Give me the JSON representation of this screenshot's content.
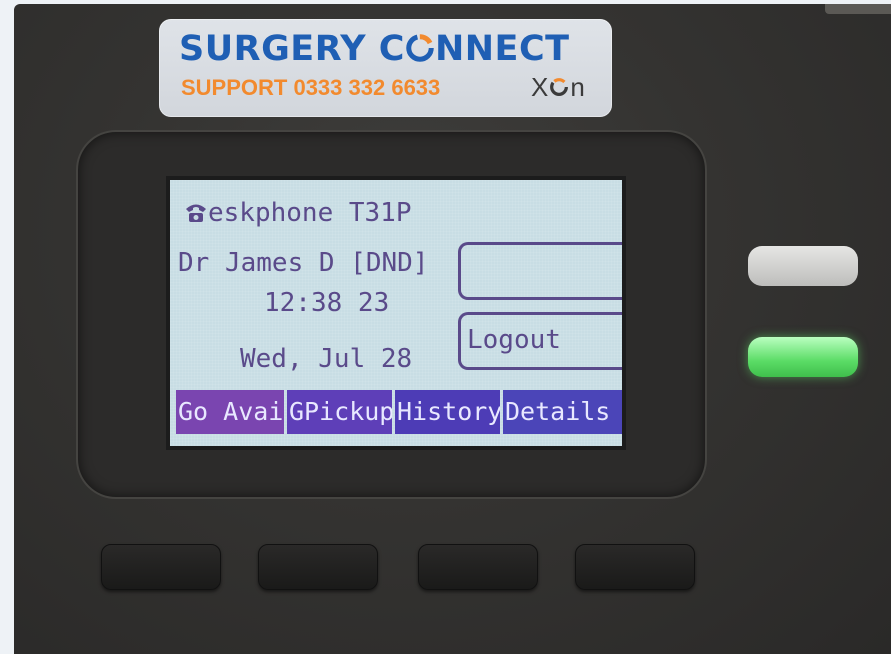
{
  "sticker": {
    "brand_prefix": "SURGERY C",
    "brand_suffix": "NNECT",
    "support": "SUPPORT 0333 332 6633",
    "logo_x": "X",
    "logo_n": "n"
  },
  "screen": {
    "title": "eskphone T31P",
    "user_status": "Dr James D [DND]",
    "time": "12:38 23",
    "date": "Wed, Jul 28",
    "line_keys": [
      "",
      "Logout"
    ],
    "softkeys": [
      "Go Avai",
      "GPickup",
      "History",
      "Details"
    ]
  },
  "colors": {
    "brand_blue": "#1f5fb4",
    "brand_orange": "#f28a2e",
    "lcd_text": "#5a4a8a",
    "line_key_led": "#5bdc66"
  },
  "icons": {
    "title_icon": "phone-handset-icon"
  }
}
